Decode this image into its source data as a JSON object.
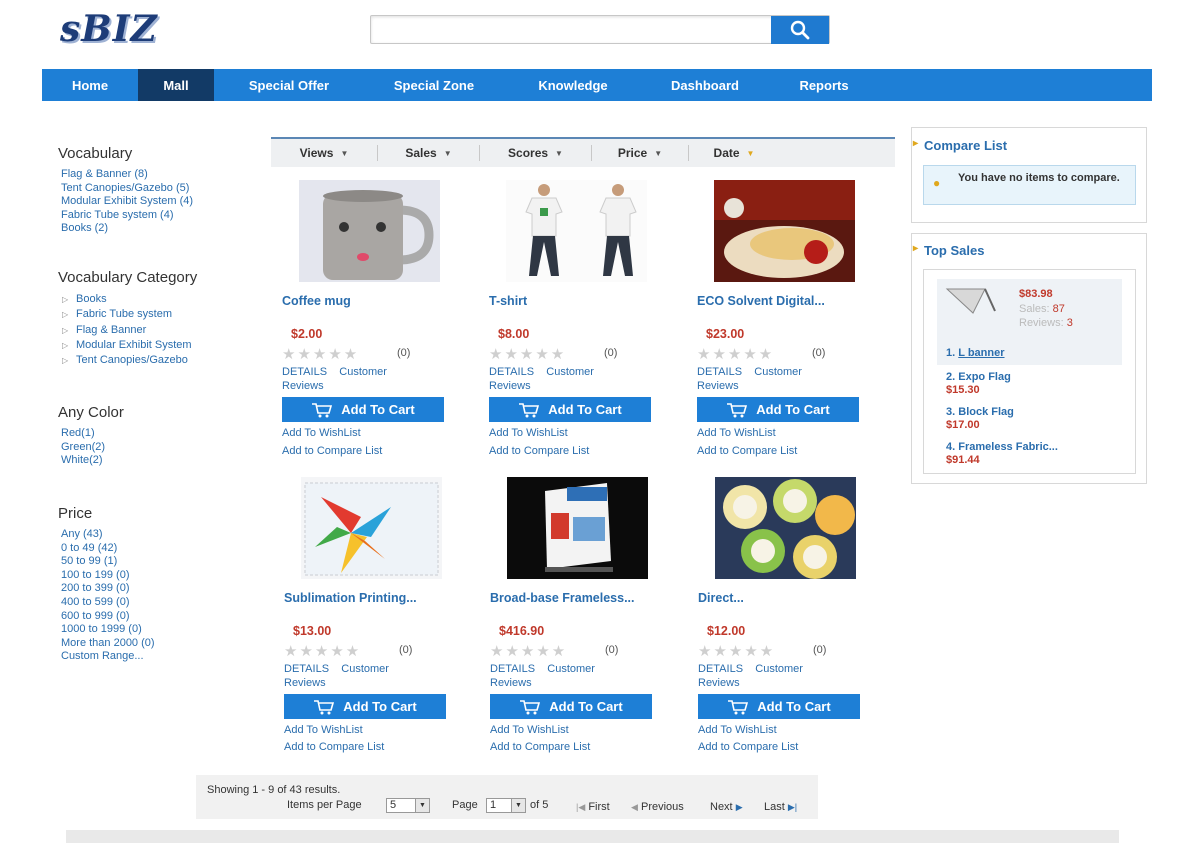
{
  "brand": {
    "logo_text": "sBIZ"
  },
  "search": {
    "placeholder": "",
    "value": "",
    "button_icon": "search-icon"
  },
  "nav": {
    "items": [
      {
        "label": "Home",
        "active": false
      },
      {
        "label": "Mall",
        "active": true
      },
      {
        "label": "Special Offer",
        "active": false
      },
      {
        "label": "Special Zone",
        "active": false
      },
      {
        "label": "Knowledge",
        "active": false
      },
      {
        "label": "Dashboard",
        "active": false
      },
      {
        "label": "Reports",
        "active": false
      }
    ]
  },
  "sidebar": {
    "vocabulary": {
      "title": "Vocabulary",
      "items": [
        "Flag & Banner (8)",
        "Tent Canopies/Gazebo (5)",
        "Modular Exhibit System (4)",
        "Fabric Tube system (4)",
        "Books (2)"
      ]
    },
    "vocabulary_category": {
      "title": "Vocabulary Category",
      "items": [
        "Books",
        "Fabric Tube system",
        "Flag & Banner",
        "Modular Exhibit System",
        "Tent Canopies/Gazebo"
      ]
    },
    "color": {
      "title": "Any Color",
      "items": [
        "Red(1)",
        "Green(2)",
        "White(2)"
      ]
    },
    "price": {
      "title": "Price",
      "items": [
        "Any (43)",
        "0 to 49 (42)",
        "50 to 99 (1)",
        "100 to 199 (0)",
        "200 to 399 (0)",
        "400 to 599 (0)",
        "600 to 999 (0)",
        "1000 to 1999 (0)",
        "More than 2000 (0)",
        "Custom Range..."
      ]
    }
  },
  "sort": {
    "items": [
      "Views",
      "Sales",
      "Scores",
      "Price",
      "Date"
    ]
  },
  "product_labels": {
    "details": "DETAILS",
    "customer": "Customer",
    "reviews": "Reviews",
    "add_to_cart": "Add To Cart",
    "wishlist": "Add To WishList",
    "compare": "Add to Compare List"
  },
  "products": [
    {
      "name": "Coffee mug",
      "price": "$2.00",
      "rating": 0,
      "review_count": "(0)"
    },
    {
      "name": "T-shirt",
      "price": "$8.00",
      "rating": 0,
      "review_count": "(0)"
    },
    {
      "name": "ECO Solvent Digital...",
      "price": "$23.00",
      "rating": 0,
      "review_count": "(0)"
    },
    {
      "name": "Sublimation Printing...",
      "price": "$13.00",
      "rating": 0,
      "review_count": "(0)"
    },
    {
      "name": "Broad-base Frameless...",
      "price": "$416.90",
      "rating": 0,
      "review_count": "(0)"
    },
    {
      "name": "Direct...",
      "price": "$12.00",
      "rating": 0,
      "review_count": "(0)"
    }
  ],
  "pager": {
    "showing": "Showing 1 - 9 of 43 results.",
    "items_per_page_label": "Items per Page",
    "items_per_page": "5",
    "page_label": "Page",
    "page": "1",
    "of": "of 5",
    "first": "First",
    "previous": "Previous",
    "next": "Next",
    "last": "Last"
  },
  "compare": {
    "title": "Compare List",
    "message": "You have no items to compare."
  },
  "top_sales": {
    "title": "Top Sales",
    "featured": {
      "price": "$83.98",
      "sales_label": "Sales:",
      "sales": "87",
      "reviews_label": "Reviews:",
      "reviews": "3"
    },
    "items": [
      {
        "rank": "1.",
        "name": "L banner",
        "price": ""
      },
      {
        "rank": "2.",
        "name": "Expo Flag",
        "price": "$15.30"
      },
      {
        "rank": "3.",
        "name": "Block Flag",
        "price": "$17.00"
      },
      {
        "rank": "4.",
        "name": "Frameless Fabric...",
        "price": "$91.44"
      }
    ]
  },
  "colors": {
    "accent": "#1e7fd6",
    "nav_active": "#123a66",
    "link": "#2a6dad",
    "price": "#c0392b"
  }
}
